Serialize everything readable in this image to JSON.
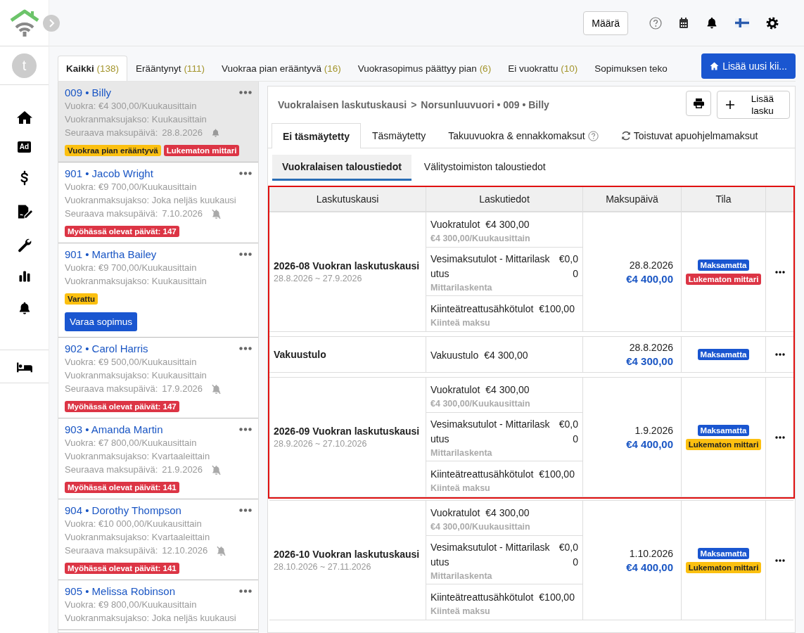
{
  "sidebar": {
    "avatar": "t",
    "ad_label": "Ad"
  },
  "header": {
    "amount_button": "Määrä"
  },
  "tabs": [
    {
      "label": "Kaikki",
      "count": "(138)",
      "selected": true
    },
    {
      "label": "Erääntynyt",
      "count": "(111)",
      "selected": false
    },
    {
      "label": "Vuokraa pian erääntyvä",
      "count": "(16)",
      "selected": false
    },
    {
      "label": "Vuokrasopimus päättyy pian",
      "count": "(6)",
      "selected": false
    },
    {
      "label": "Ei vuokrattu",
      "count": "(10)",
      "selected": false
    },
    {
      "label": "Sopimuksen teko",
      "selected": false
    }
  ],
  "add_button": "Lisää uusi kii...",
  "tenants": [
    {
      "title": "009 • Billy",
      "selected": true,
      "lines": [
        "Vuokra: €4 300,00/Kuukausittain",
        "Vuokranmaksujakso: Kuukausittain"
      ],
      "next_due": {
        "label": "Seuraava maksupäivä:",
        "date": "28.8.2026",
        "reminder": true
      },
      "badges": [
        {
          "label": "Vuokraa pian erääntyvä",
          "kind": "warning"
        },
        {
          "label": "Lukematon mittari",
          "kind": "danger"
        }
      ]
    },
    {
      "title": "901 • Jacob Wright",
      "selected": false,
      "lines": [
        "Vuokra: €9 700,00/Kuukausittain",
        "Vuokranmaksujakso: Joka neljäs kuukausi"
      ],
      "next_due": {
        "label": "Seuraava maksupäivä:",
        "date": "7.10.2026",
        "reminder": false
      },
      "badges": [
        {
          "label": "Myöhässä olevat päivät: 147",
          "kind": "danger"
        }
      ]
    },
    {
      "title": "901 • Martha Bailey",
      "selected": false,
      "lines": [
        "Vuokra: €9 700,00/Kuukausittain",
        "Vuokranmaksujakso: Kuukausittain"
      ],
      "badges": [
        {
          "label": "Varattu",
          "kind": "warning"
        }
      ],
      "action": "Varaa sopimus"
    },
    {
      "title": "902 • Carol Harris",
      "selected": false,
      "lines": [
        "Vuokra: €9 500,00/Kuukausittain",
        "Vuokranmaksujakso: Kuukausittain"
      ],
      "next_due": {
        "label": "Seuraava maksupäivä:",
        "date": "17.9.2026",
        "reminder": false
      },
      "badges": [
        {
          "label": "Myöhässä olevat päivät: 147",
          "kind": "danger"
        }
      ]
    },
    {
      "title": "903 • Amanda Martin",
      "selected": false,
      "lines": [
        "Vuokra: €7 800,00/Kuukausittain",
        "Vuokranmaksujakso: Kvartaaleittain"
      ],
      "next_due": {
        "label": "Seuraava maksupäivä:",
        "date": "21.9.2026",
        "reminder": false
      },
      "badges": [
        {
          "label": "Myöhässä olevat päivät: 141",
          "kind": "danger"
        }
      ]
    },
    {
      "title": "904 • Dorothy Thompson",
      "selected": false,
      "lines": [
        "Vuokra: €10 000,00/Kuukausittain",
        "Vuokranmaksujakso: Kvartaaleittain"
      ],
      "next_due": {
        "label": "Seuraava maksupäivä:",
        "date": "12.10.2026",
        "reminder": false
      },
      "badges": [
        {
          "label": "Myöhässä olevat päivät: 141",
          "kind": "danger"
        }
      ]
    },
    {
      "title": "905 • Melissa Robinson",
      "selected": false,
      "lines": [
        "Vuokra: €9 800,00/Kuukausittain",
        "Vuokranmaksujakso: Joka neljäs kuukausi"
      ]
    }
  ],
  "breadcrumb": {
    "items": [
      "Vuokralaisen laskutuskausi",
      "Norsunluuvuori • 009 • Billy"
    ],
    "separator": ">"
  },
  "add_invoice_button": "Lisää lasku",
  "panel_tabs": [
    {
      "label": "Ei täsmäytetty",
      "kind": "plain",
      "selected": true
    },
    {
      "label": "Täsmäytetty",
      "kind": "plain",
      "selected": false
    },
    {
      "label": "Takuuvuokra & ennakkomaksut",
      "kind": "help",
      "selected": false
    },
    {
      "label": "Toistuvat apuohjelmamaksut",
      "kind": "recurring",
      "selected": false
    }
  ],
  "sub_tabs": [
    {
      "label": "Vuokralaisen taloustiedot",
      "selected": true
    },
    {
      "label": "Välitystoimiston taloustiedot",
      "selected": false
    }
  ],
  "table": {
    "columns": [
      "Laskutuskausi",
      "Laskutiedot",
      "Maksupäivä",
      "Tila"
    ],
    "rows": [
      {
        "period": "2026-08 Vuokran laskutuskausi",
        "range": "28.8.2026 ~ 27.9.2026",
        "highlighted": true,
        "items": [
          {
            "name": "Vuokratulot",
            "amount": "€4 300,00",
            "note": "€4 300,00/Kuukausittain"
          },
          {
            "name": "Vesimaksutulot - Mittarilaskutus",
            "amount": "€0,00",
            "note": "Mittarilaskenta"
          },
          {
            "name": "Kiinteätreattusähkötulot",
            "amount": "€100,00",
            "note": "Kiinteä maksu"
          }
        ],
        "due": "28.8.2026",
        "total": "€4 400,00",
        "statuses": [
          {
            "label": "Maksamatta",
            "kind": "primary"
          },
          {
            "label": "Lukematon mittari",
            "kind": "danger"
          }
        ]
      },
      {
        "period": "Vakuustulo",
        "highlighted": true,
        "items": [
          {
            "name": "Vakuustulo",
            "amount": "€4 300,00"
          }
        ],
        "due": "28.8.2026",
        "total": "€4 300,00",
        "statuses": [
          {
            "label": "Maksamatta",
            "kind": "primary"
          }
        ]
      },
      {
        "period": "2026-09 Vuokran laskutuskausi",
        "range": "28.9.2026 ~ 27.10.2026",
        "highlighted": true,
        "items": [
          {
            "name": "Vuokratulot",
            "amount": "€4 300,00",
            "note": "€4 300,00/Kuukausittain"
          },
          {
            "name": "Vesimaksutulot - Mittarilaskutus",
            "amount": "€0,00",
            "note": "Mittarilaskenta"
          },
          {
            "name": "Kiinteätreattusähkötulot",
            "amount": "€100,00",
            "note": "Kiinteä maksu"
          }
        ],
        "due": "1.9.2026",
        "total": "€4 400,00",
        "statuses": [
          {
            "label": "Maksamatta",
            "kind": "primary"
          },
          {
            "label": "Lukematon mittari",
            "kind": "warning"
          }
        ]
      },
      {
        "period": "2026-10 Vuokran laskutuskausi",
        "range": "28.10.2026 ~ 27.11.2026",
        "highlighted": false,
        "items": [
          {
            "name": "Vuokratulot",
            "amount": "€4 300,00",
            "note": "€4 300,00/Kuukausittain"
          },
          {
            "name": "Vesimaksutulot - Mittarilaskutus",
            "amount": "€0,00",
            "note": "Mittarilaskenta"
          },
          {
            "name": "Kiinteätreattusähkötulot",
            "amount": "€100,00",
            "note": "Kiinteä maksu"
          }
        ],
        "due": "1.10.2026",
        "total": "€4 400,00",
        "statuses": [
          {
            "label": "Maksamatta",
            "kind": "primary"
          },
          {
            "label": "Lukematon mittari",
            "kind": "warning"
          }
        ]
      }
    ]
  }
}
